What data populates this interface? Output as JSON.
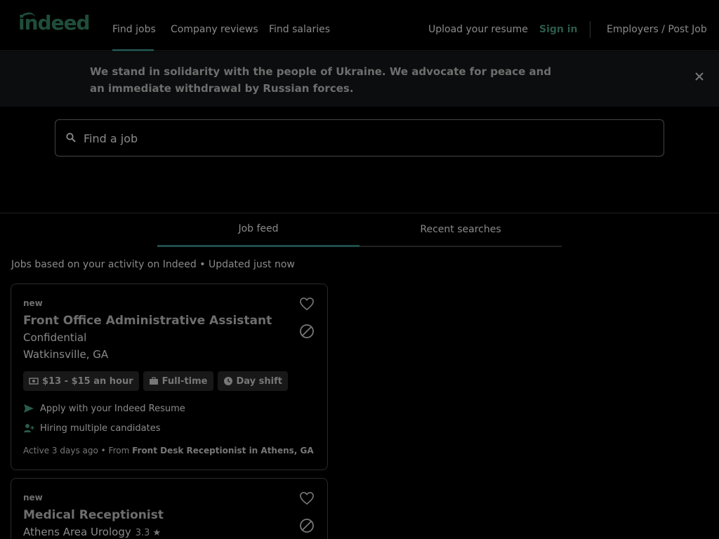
{
  "header": {
    "logo": "indeed",
    "nav": {
      "find_jobs": "Find jobs",
      "company_reviews": "Company reviews",
      "find_salaries": "Find salaries"
    },
    "upload_resume": "Upload your resume",
    "sign_in": "Sign in",
    "employers": "Employers / Post Job"
  },
  "banner": {
    "text": "We stand in solidarity with the people of Ukraine. We advocate for peace and an immediate withdrawal by Russian forces.",
    "close_icon": "close-icon"
  },
  "search": {
    "placeholder": "Find a job",
    "icon": "search-icon"
  },
  "tabs": [
    {
      "label": "Job feed",
      "active": true
    },
    {
      "label": "Recent searches",
      "active": false
    }
  ],
  "feed_info": "Jobs based on your activity on Indeed • Updated just now",
  "jobs": [
    {
      "badge": "new",
      "title": "Front Office Administrative Assistant",
      "company": "Confidential",
      "location": "Watkinsville, GA",
      "tags": [
        {
          "icon": "money-icon",
          "label": "$13 - $15 an hour"
        },
        {
          "icon": "briefcase-icon",
          "label": "Full-time"
        },
        {
          "icon": "clock-icon",
          "label": "Day shift"
        }
      ],
      "features": [
        {
          "icon": "send-icon",
          "label": "Apply with your Indeed Resume"
        },
        {
          "icon": "person-add-icon",
          "label": "Hiring multiple candidates"
        }
      ],
      "footer_prefix": "Active 3 days ago • From ",
      "footer_source": "Front Desk Receptionist in Athens, GA"
    },
    {
      "badge": "new",
      "title": "Medical Receptionist",
      "company": "Athens Area Urology",
      "rating": "3.3 ★"
    }
  ],
  "colors": {
    "accent": "#1f4d4a",
    "brand": "#1f4d3b"
  }
}
